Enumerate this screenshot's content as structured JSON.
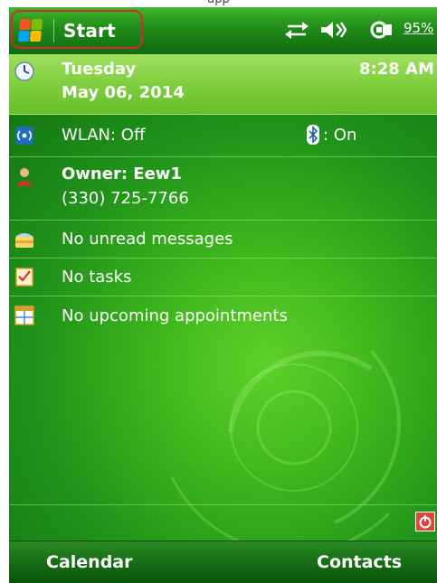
{
  "caption": "app",
  "titlebar": {
    "start_label": "Start",
    "battery_percent": "95%"
  },
  "today": {
    "day": "Tuesday",
    "date": "May 06, 2014",
    "time": "8:28 AM"
  },
  "connectivity": {
    "wlan": "WLAN: Off",
    "bluetooth": ": On"
  },
  "owner": {
    "name": "Owner: Eew1",
    "phone": "(330) 725-7766"
  },
  "messages": "No unread messages",
  "tasks": "No tasks",
  "appointments": "No upcoming appointments",
  "softkeys": {
    "left": "Calendar",
    "right": "Contacts"
  },
  "colors": {
    "start_highlight": "#d7263d",
    "background": "#21941a",
    "row_highlight": "#7fcf3d"
  }
}
